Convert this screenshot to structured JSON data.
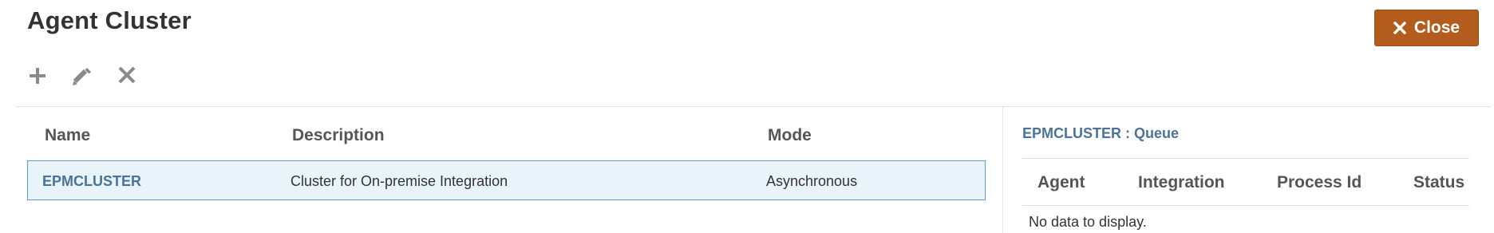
{
  "header": {
    "title": "Agent Cluster",
    "close_label": "Close"
  },
  "toolbar": {
    "icons": {
      "add": "plus-icon",
      "edit": "pencil-icon",
      "delete": "x-icon"
    }
  },
  "cluster_table": {
    "columns": [
      "Name",
      "Description",
      "Mode"
    ],
    "rows": [
      {
        "name": "EPMCLUSTER",
        "description": "Cluster for On-premise Integration",
        "mode": "Asynchronous",
        "selected": true
      }
    ]
  },
  "queue_panel": {
    "title": "EPMCLUSTER : Queue",
    "columns": [
      "Agent",
      "Integration",
      "Process Id",
      "Status"
    ],
    "empty_text": "No data to display."
  },
  "colors": {
    "close_button": "#b35c1e",
    "link_text": "#4a7397",
    "selected_row_bg": "#e8f3fa",
    "selected_row_border": "#5b9fd2",
    "icon": "#8a8a8a"
  }
}
